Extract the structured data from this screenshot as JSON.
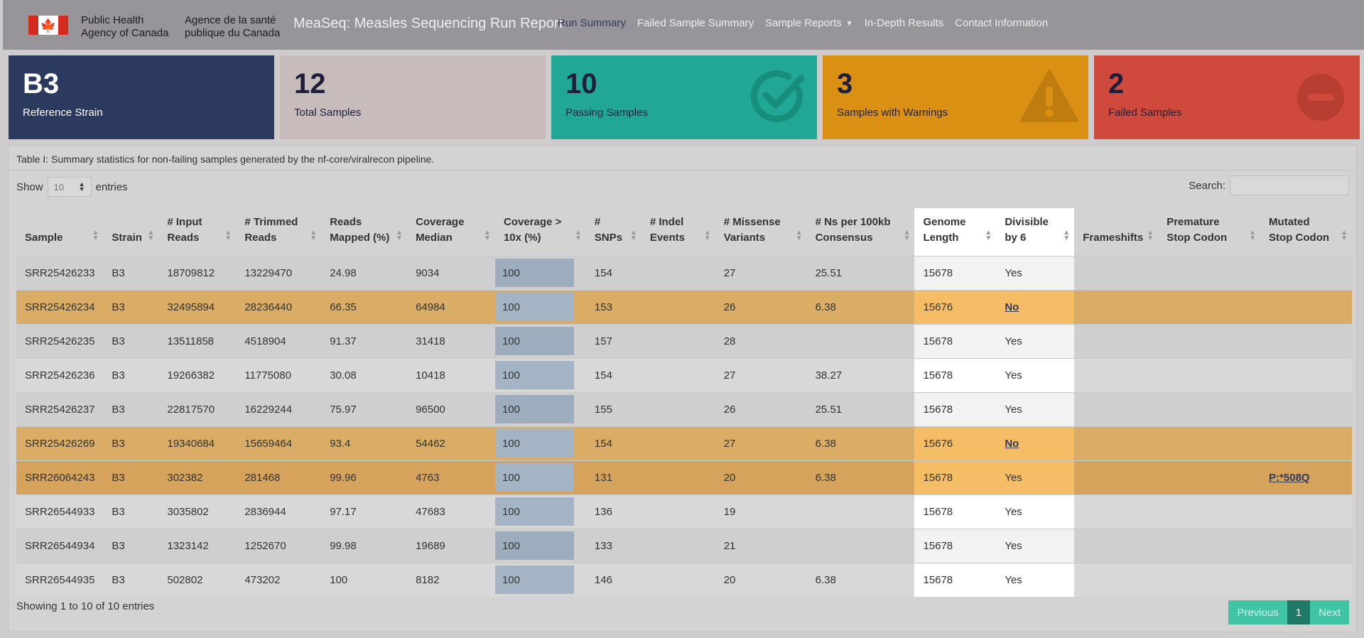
{
  "navbar": {
    "gov_en": [
      "Public Health",
      "Agency of Canada"
    ],
    "gov_fr": [
      "Agence de la santé",
      "publique du Canada"
    ],
    "title": "MeaSeq: Measles Sequencing Run Report",
    "links": [
      {
        "label": "Run Summary",
        "active": true
      },
      {
        "label": "Failed Sample Summary"
      },
      {
        "label": "Sample Reports",
        "dropdown": true
      },
      {
        "label": "In-Depth Results"
      },
      {
        "label": "Contact Information"
      }
    ]
  },
  "cards": [
    {
      "value": "B3",
      "label": "Reference Strain",
      "color": "#2d3a5f"
    },
    {
      "value": "12",
      "label": "Total Samples",
      "color": "#c7bbbb"
    },
    {
      "value": "10",
      "label": "Passing Samples",
      "color": "#20a796",
      "icon": "check-circle-icon"
    },
    {
      "value": "3",
      "label": "Samples with Warnings",
      "color": "#da9012",
      "icon": "warning-triangle-icon"
    },
    {
      "value": "2",
      "label": "Failed Samples",
      "color": "#cf4a3c",
      "icon": "minus-circle-icon"
    }
  ],
  "table": {
    "caption": "Table I: Summary statistics for non-failing samples generated by the nf-core/viralrecon pipeline.",
    "show_label": "Show",
    "entries_label": "entries",
    "page_size": "10",
    "search_label": "Search:",
    "columns": [
      [
        "Sample"
      ],
      [
        "Strain"
      ],
      [
        "# Input",
        "Reads"
      ],
      [
        "# Trimmed",
        "Reads"
      ],
      [
        "Reads",
        "Mapped (%)"
      ],
      [
        "Coverage",
        "Median"
      ],
      [
        "Coverage >",
        "10x (%)"
      ],
      [
        "#",
        "SNPs"
      ],
      [
        "# Indel",
        "Events"
      ],
      [
        "# Missense",
        "Variants"
      ],
      [
        "# Ns per 100kb",
        "Consensus"
      ],
      [
        "Genome",
        "Length"
      ],
      [
        "Divisible",
        "by 6"
      ],
      [
        "Frameshifts"
      ],
      [
        "Premature",
        "Stop Codon"
      ],
      [
        "Mutated",
        "Stop Codon"
      ]
    ],
    "rows": [
      [
        "SRR25426233",
        "B3",
        "18709812",
        "13229470",
        "24.98",
        "9034",
        "100",
        "154",
        "",
        "27",
        "25.51",
        "15678",
        "Yes",
        "",
        "",
        ""
      ],
      [
        "SRR25426234",
        "B3",
        "32495894",
        "28236440",
        "66.35",
        "64984",
        "100",
        "153",
        "",
        "26",
        "6.38",
        "15676",
        "No",
        "",
        "",
        ""
      ],
      [
        "SRR25426235",
        "B3",
        "13511858",
        "4518904",
        "91.37",
        "31418",
        "100",
        "157",
        "",
        "28",
        "",
        "15678",
        "Yes",
        "",
        "",
        ""
      ],
      [
        "SRR25426236",
        "B3",
        "19266382",
        "11775080",
        "30.08",
        "10418",
        "100",
        "154",
        "",
        "27",
        "38.27",
        "15678",
        "Yes",
        "",
        "",
        ""
      ],
      [
        "SRR25426237",
        "B3",
        "22817570",
        "16229244",
        "75.97",
        "96500",
        "100",
        "155",
        "",
        "26",
        "25.51",
        "15678",
        "Yes",
        "",
        "",
        ""
      ],
      [
        "SRR25426269",
        "B3",
        "19340684",
        "15659464",
        "93.4",
        "54462",
        "100",
        "154",
        "",
        "27",
        "6.38",
        "15676",
        "No",
        "",
        "",
        ""
      ],
      [
        "SRR26064243",
        "B3",
        "302382",
        "281468",
        "99.96",
        "4763",
        "100",
        "131",
        "",
        "20",
        "6.38",
        "15678",
        "Yes",
        "",
        "",
        "P:*508Q"
      ],
      [
        "SRR26544933",
        "B3",
        "3035802",
        "2836944",
        "97.17",
        "47683",
        "100",
        "136",
        "",
        "19",
        "",
        "15678",
        "Yes",
        "",
        "",
        ""
      ],
      [
        "SRR26544934",
        "B3",
        "1323142",
        "1252670",
        "99.98",
        "19689",
        "100",
        "133",
        "",
        "21",
        "",
        "15678",
        "Yes",
        "",
        "",
        ""
      ],
      [
        "SRR26544935",
        "B3",
        "502802",
        "473202",
        "100",
        "8182",
        "100",
        "146",
        "",
        "20",
        "6.38",
        "15678",
        "Yes",
        "",
        "",
        ""
      ]
    ],
    "row_status": [
      "pass",
      "warn",
      "pass",
      "pass",
      "pass",
      "warn",
      "warn",
      "pass",
      "pass",
      "pass"
    ],
    "info": "Showing 1 to 10 of 10 entries",
    "pager": {
      "prev": "Previous",
      "current": "1",
      "next": "Next"
    }
  }
}
